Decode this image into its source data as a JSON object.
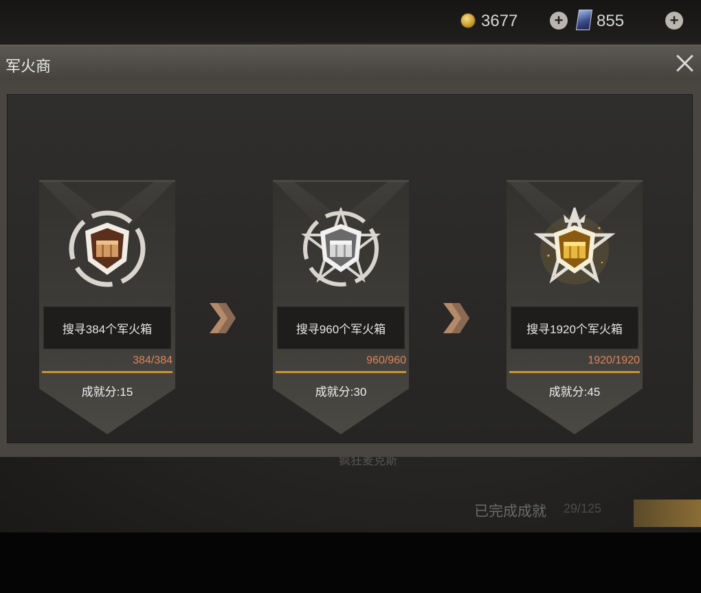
{
  "currency": {
    "coins": "3677",
    "cards": "855",
    "coin_icon": "gold-coin-icon",
    "card_icon": "card-icon",
    "plus_icon": "plus-icon"
  },
  "dialog": {
    "title": "军火商",
    "close_icon": "close-icon"
  },
  "achievements": [
    {
      "tier": "bronze",
      "task": "搜寻384个军火箱",
      "progress": "384/384",
      "score": "成就分:15",
      "badge_color": "#c98a55"
    },
    {
      "tier": "silver",
      "task": "搜寻960个军火箱",
      "progress": "960/960",
      "score": "成就分:30",
      "badge_color": "#cfcfcf"
    },
    {
      "tier": "gold",
      "task": "搜寻1920个军火箱",
      "progress": "1920/1920",
      "score": "成就分:45",
      "badge_color": "#e6b94a"
    }
  ],
  "background": {
    "title": "疯狂麦克斯",
    "completed_label": "已完成成就",
    "completed_count": "29/125"
  },
  "colors": {
    "progress_text": "#e0845a",
    "progress_line": "#c9942e",
    "accent": "#c9942e"
  }
}
